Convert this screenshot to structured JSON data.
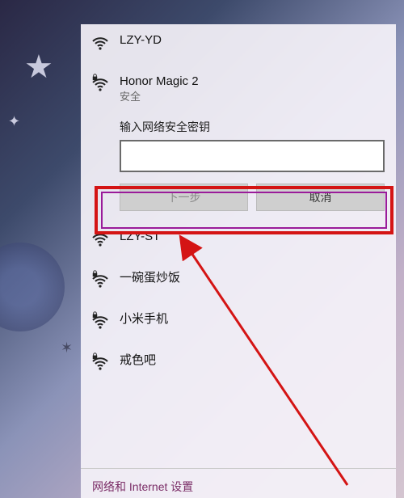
{
  "networks": [
    {
      "ssid": "LZY-YD",
      "secured": false
    },
    {
      "ssid": "Honor Magic 2",
      "secured": true,
      "status": "安全",
      "expanded": true
    },
    {
      "ssid": "LZY-ST",
      "secured": false
    },
    {
      "ssid": "一碗蛋炒饭",
      "secured": true
    },
    {
      "ssid": "小米手机",
      "secured": true
    },
    {
      "ssid": "戒色吧",
      "secured": true
    }
  ],
  "password_prompt": {
    "label": "输入网络安全密钥",
    "value": "",
    "next_label": "下一步",
    "cancel_label": "取消",
    "next_enabled": false
  },
  "footer": {
    "settings_link": "网络和 Internet 设置"
  },
  "colors": {
    "annotation_red": "#d41414",
    "annotation_purple": "#9a1b9a",
    "link": "#7a2c66"
  }
}
